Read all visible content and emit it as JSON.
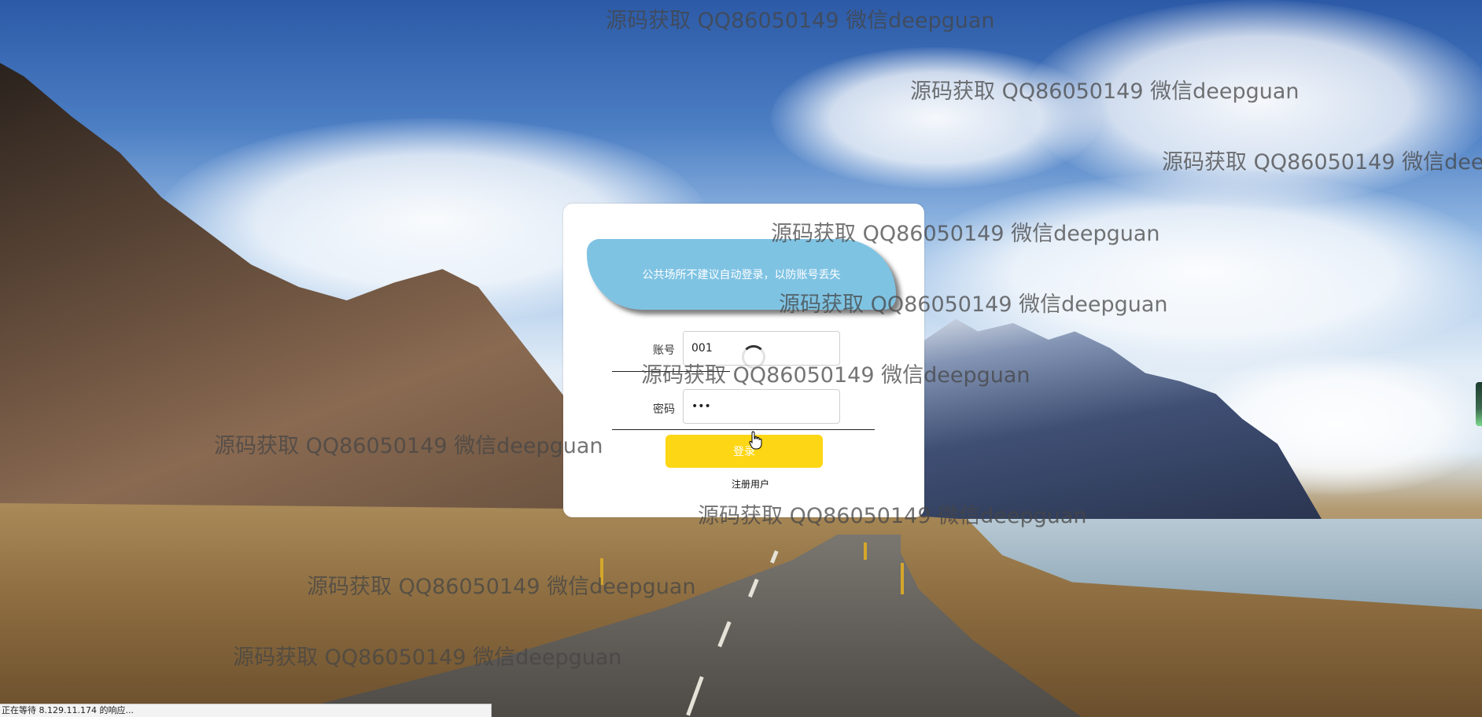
{
  "notice": {
    "text": "公共场所不建议自动登录，以防账号丢失"
  },
  "form": {
    "account_label": "账号",
    "account_value": "001",
    "password_label": "密码",
    "password_value": "123",
    "login_button": "登录",
    "register_link": "注册用户"
  },
  "status_bar": {
    "text": "正在等待 8.129.11.174 的响应..."
  },
  "watermark": {
    "text": "源码获取 QQ86050149 微信deepguan"
  },
  "colors": {
    "notice_bg": "#7fc3e3",
    "login_button_bg": "#fdd615"
  },
  "icons": {
    "spinner": "loading-spinner-icon",
    "cursor": "hand-cursor-icon"
  }
}
